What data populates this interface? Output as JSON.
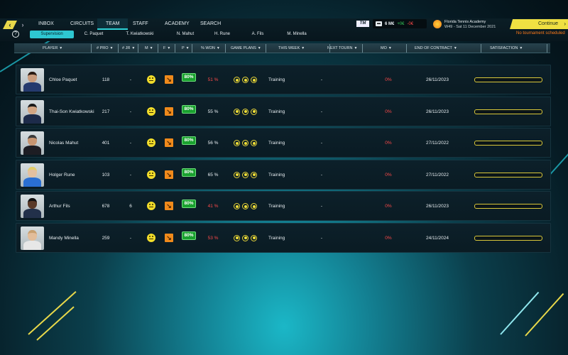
{
  "nav": {
    "back_icon": "chevron-left-icon",
    "forward_icon": "chevron-right-icon",
    "back_glyph": "‹",
    "forward_glyph": "›",
    "tabs": [
      "INBOX",
      "CIRCUITS",
      "TEAM",
      "STAFF",
      "ACADEMY",
      "SEARCH"
    ],
    "active_tab": "TEAM"
  },
  "help_glyph": "?",
  "subtabs": {
    "items": [
      "Supervision",
      "C. Paquet",
      "T. Kwiatkowski",
      "N. Mahut",
      "H. Rune",
      "A. Fils",
      "M. Minella"
    ],
    "active": "Supervision"
  },
  "status": {
    "tm_logo": "TM",
    "balance": "6 M€",
    "income": "+0€",
    "expense": "-0€",
    "academy_name": "Florida Tennis Academy",
    "date": "W49 - Sat 11 December 2021",
    "continue_label": "Continue",
    "continue_icon": "arrow-right-icon",
    "continue_glyph": "›",
    "tournament_status": "No tournament scheduled"
  },
  "columns": [
    "PLAYER",
    "# PRO",
    "# JR",
    "M",
    "F",
    "P",
    "% WON",
    "GAME PLANS",
    "THIS WEEK",
    "NEXT TOURN",
    "MO",
    "END OF CONTRACT",
    "SATISFACTION"
  ],
  "colors": {
    "accent": "#2ec7d1",
    "continue": "#f0e042",
    "positive": "#34c759",
    "negative": "#ff4a4a",
    "form_badge": "#1aa12f",
    "mood": "#f2dd2a",
    "trend": "#f08a1b"
  },
  "players": [
    {
      "name": "Chloe Paquet",
      "pro": "118",
      "jr": "-",
      "form": "80%",
      "won": "51 %",
      "won_bad": true,
      "week": "Training",
      "next": "-",
      "mo": "0%",
      "contract": "26/11/2023",
      "satisfaction": 0
    },
    {
      "name": "Thai-Son Kwiatkowski",
      "pro": "217",
      "jr": "-",
      "form": "80%",
      "won": "55 %",
      "won_bad": false,
      "week": "Training",
      "next": "-",
      "mo": "0%",
      "contract": "26/11/2023",
      "satisfaction": 0
    },
    {
      "name": "Nicolas Mahut",
      "pro": "401",
      "jr": "-",
      "form": "80%",
      "won": "56 %",
      "won_bad": false,
      "week": "Training",
      "next": "-",
      "mo": "0%",
      "contract": "27/11/2022",
      "satisfaction": 0
    },
    {
      "name": "Holger Rune",
      "pro": "103",
      "jr": "-",
      "form": "80%",
      "won": "65 %",
      "won_bad": false,
      "week": "Training",
      "next": "-",
      "mo": "0%",
      "contract": "27/11/2022",
      "satisfaction": 0
    },
    {
      "name": "Arthur Fils",
      "pro": "678",
      "jr": "6",
      "form": "80%",
      "won": "41 %",
      "won_bad": true,
      "week": "Training",
      "next": "-",
      "mo": "0%",
      "contract": "26/11/2023",
      "satisfaction": 0
    },
    {
      "name": "Mandy Minella",
      "pro": "259",
      "jr": "-",
      "form": "80%",
      "won": "53 %",
      "won_bad": true,
      "week": "Training",
      "next": "-",
      "mo": "0%",
      "contract": "24/11/2024",
      "satisfaction": 0
    }
  ]
}
